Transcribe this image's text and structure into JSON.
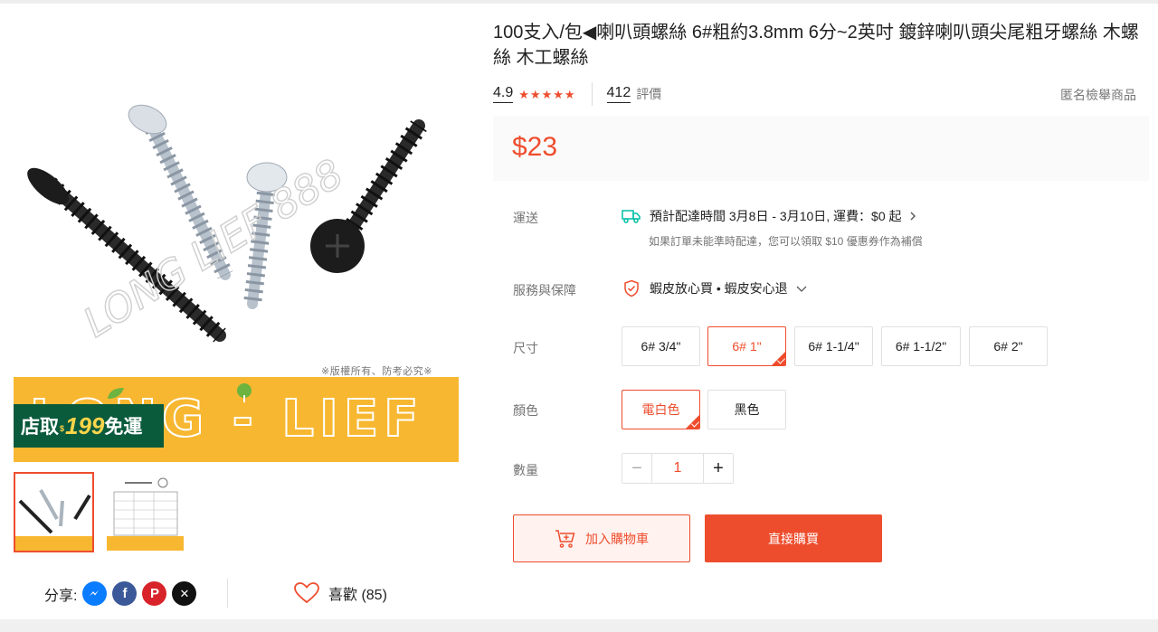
{
  "gallery": {
    "watermark": "LONG LIEF 888",
    "copyright": "※版權所有、防考必究※",
    "brand": "LONG - LIEF",
    "promo": {
      "part1": "店取",
      "part2": "$",
      "part3": "199",
      "part4": "免運"
    },
    "thumbnails": [
      {
        "name": "thumb-screws",
        "active": true
      },
      {
        "name": "thumb-spec-table",
        "active": false
      }
    ]
  },
  "share": {
    "label": "分享:",
    "icons": [
      "messenger-icon",
      "facebook-icon",
      "pinterest-icon",
      "x-icon"
    ]
  },
  "like": {
    "label": "喜歡 (85)"
  },
  "product": {
    "title": "100支入/包◀喇叭頭螺絲 6#粗約3.8mm 6分~2英吋 鍍鋅喇叭頭尖尾粗牙螺絲 木螺絲 木工螺絲",
    "rating": "4.9",
    "stars": 5,
    "review_count": "412",
    "review_label": "評價",
    "report": "匿名檢舉商品",
    "price": "$23"
  },
  "shipping": {
    "label": "運送",
    "eta": "預計配達時間 3月8日 - 3月10日, 運費：$0 起",
    "note": "如果訂單未能準時配達，您可以領取 $10 優惠券作為補償"
  },
  "service": {
    "label": "服務與保障",
    "value": "蝦皮放心買 • 蝦皮安心退"
  },
  "size": {
    "label": "尺寸",
    "options": [
      "6# 3/4\"",
      "6# 1\"",
      "6# 1-1/4\"",
      "6# 1-1/2\"",
      "6# 2\""
    ],
    "selected_index": 1
  },
  "color": {
    "label": "顏色",
    "options": [
      "電白色",
      "黑色"
    ],
    "selected_index": 0
  },
  "quantity": {
    "label": "數量",
    "value": "1",
    "minus": "−",
    "plus": "+"
  },
  "actions": {
    "add_to_cart": "加入購物車",
    "buy_now": "直接購買"
  },
  "colors": {
    "accent": "#ee4d2d",
    "brand_yellow": "#f7b731",
    "promo_green": "#0a5a3c"
  }
}
